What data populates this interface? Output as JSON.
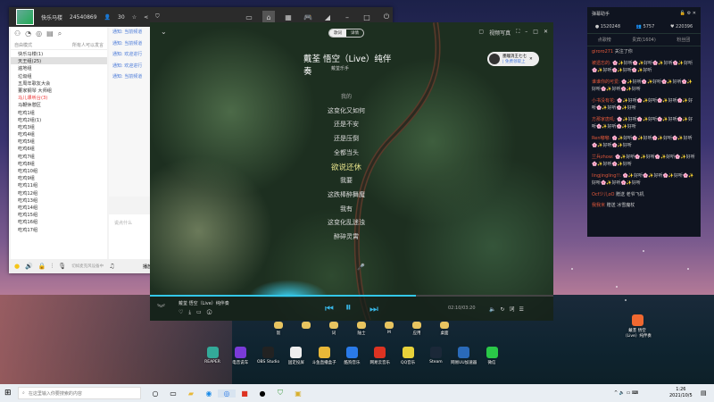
{
  "app": {
    "name": "快乐马楼",
    "id": "24540869",
    "count": "30",
    "left_header": "自由模式",
    "left_header_right": "所有人可以发言",
    "groups": [
      {
        "label": "快乐马楼(1)"
      },
      {
        "label": "天王组(25)",
        "sel": true
      },
      {
        "label": "遍地组"
      },
      {
        "label": "垃圾组"
      },
      {
        "label": "五周年歌友大会"
      },
      {
        "label": "董家钢琴 大师组"
      },
      {
        "label": "马儿课听台(3)",
        "red": true
      },
      {
        "label": "马鞭休憩区"
      },
      {
        "label": "吃鸡1组"
      },
      {
        "label": "吃鸡2组(1)"
      },
      {
        "label": "吃鸡3组"
      },
      {
        "label": "吃鸡4组"
      },
      {
        "label": "吃鸡5组"
      },
      {
        "label": "吃鸡6组"
      },
      {
        "label": "吃鸡7组"
      },
      {
        "label": "吃鸡8组"
      },
      {
        "label": "吃鸡10组"
      },
      {
        "label": "吃鸡9组"
      },
      {
        "label": "吃鸡11组"
      },
      {
        "label": "吃鸡12组"
      },
      {
        "label": "吃鸡13组"
      },
      {
        "label": "吃鸡14组"
      },
      {
        "label": "吃鸡15组"
      },
      {
        "label": "吃鸡16组"
      },
      {
        "label": "吃鸡17组"
      }
    ],
    "notices": [
      "通知: 当前频道",
      "通知: 当前频道",
      "通知: 欢迎进行",
      "通知: 欢迎进行",
      "通知: 当前频道"
    ],
    "input_placeholder": "说点什么",
    "mic_hint": "切如麦克风设备中",
    "music_btn": "播放伴奏"
  },
  "player": {
    "tabs": [
      "歌词",
      "详情"
    ],
    "title": "戴荃 悟空（Live）纯伴奏",
    "artist": "戴荃乐手",
    "user_pill": {
      "name": "墨瞳消王七七",
      "sub": "| 免费领取上"
    },
    "top_label": "视频写真",
    "lyrics": [
      "我的",
      "这变化又如何",
      "还是不安",
      "还是压倒",
      "全都当头",
      "欲说还休",
      "我要",
      "这跌棒醉舞魔",
      "我有",
      "这变化乱迷浊",
      "醉碎灵霄"
    ],
    "current_index": 5,
    "bottom_title": "戴荃 悟空（Live）纯伴奏",
    "time": "02:10/03:20",
    "progress": 0.66,
    "quality": "词"
  },
  "chat": {
    "title": "弹幕助手",
    "stats": [
      "1520248",
      "5757",
      "220396"
    ],
    "tabs": [
      "点歌榜",
      "贵宾(1604)",
      "粉丝团"
    ],
    "messages": [
      {
        "user": "giroro271",
        "text": "关注了你"
      },
      {
        "user": "被遗忘的:",
        "text": "🌸✨好听🌸✨好听🌸✨好听🌸✨好听🌸✨好听🌸✨好听🌸✨好听"
      },
      {
        "user": "谁谁你的可爱:",
        "text": "🌸✨好听🌸✨好听🌸✨好听🌸✨好听🌸✨好听🌸✨好听"
      },
      {
        "user": "小书没有花:",
        "text": "🌸✨好听🌸✨好听🌸✨好听🌸✨好听🌸✨好听🌸✨好听"
      },
      {
        "user": "方那家唐叽:",
        "text": "🌸✨好听🌸✨好听🌸✨好听🌸✨好听🌸✨好听🌸✨好听"
      },
      {
        "user": "Ren嘟嘟:",
        "text": "🌸✨好听🌸✨好听🌸✨好听🌸✨好听🌸✨好听🌸✨好听"
      },
      {
        "user": "兰兵zhow:",
        "text": "🌸✨好听🌸✨好听🌸✨好听🌸✨好听🌸✨好听🌸✨好听"
      },
      {
        "user": "lingjingling!!:",
        "text": "🌸✨好听🌸✨好听🌸✨好听🌸✨好听🌸✨好听🌸✨好听"
      },
      {
        "user": "Ocf少儿oO",
        "text": "赠送 老爷飞机"
      },
      {
        "user": "我我米",
        "text": "赠送 冰雪魔杖"
      }
    ]
  },
  "desktop": {
    "folders": [
      "饭",
      "",
      "词",
      "陆士",
      "M",
      "应用",
      "桌面"
    ],
    "icons": [
      {
        "label": "REAPER",
        "color": "#3a9"
      },
      {
        "label": "电音说车",
        "color": "#7a3bd8"
      },
      {
        "label": "OBS Studio",
        "color": "#222"
      },
      {
        "label": "固定投屏",
        "color": "#eee"
      },
      {
        "label": "斗鱼直播盒子",
        "color": "#e8b838"
      },
      {
        "label": "酷狗音乐",
        "color": "#2a7ae8"
      },
      {
        "label": "网易云音乐",
        "color": "#d32"
      },
      {
        "label": "QQ音乐",
        "color": "#e8d23a"
      },
      {
        "label": "Steam",
        "color": "#1b2838"
      },
      {
        "label": "网易UU加速器",
        "color": "#2a6ab8"
      },
      {
        "label": "微信",
        "color": "#2ac848"
      }
    ],
    "song_file": "戴荃 悟空（Live）纯伴奏"
  },
  "taskbar": {
    "search_placeholder": "在这里输入你要搜索的内容",
    "time": "1:26",
    "date": "2021/10/5"
  }
}
